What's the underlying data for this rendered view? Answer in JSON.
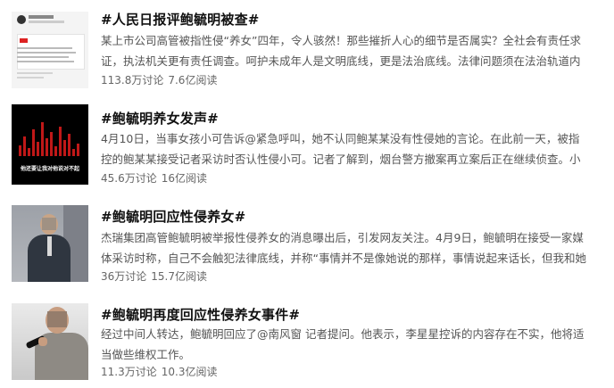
{
  "items": [
    {
      "title": "#人民日报评鲍毓明被查#",
      "desc": "某上市公司高管被指性侵“养女”四年，令人骇然！那些摧折人心的细节是否属实？全社会有责任求证，执法机关更有责任调查。呵护未成年人是文明底线，更是法治底线。法律问题须在法治轨道内解决。...",
      "discussions": "113.8万讨论",
      "reads": "7.6亿阅读"
    },
    {
      "title": "#鲍毓明养女发声#",
      "desc": "4月10日，当事女孩小可告诉@紧急呼叫，她不认同鲍某某没有性侵她的言论。在此前一天，被指控的鲍某某接受记者采访时否认性侵小可。记者了解到，烟台警方撤案再立案后正在继续侦查。小可表...",
      "discussions": "45.6万讨论",
      "reads": "16亿阅读",
      "thumb_caption": "他还要让我对他说对不起"
    },
    {
      "title": "#鲍毓明回应性侵养女#",
      "desc": "杰瑞集团高管鲍毓明被举报性侵养女的消息曝出后，引发网友关注。4月9日，鲍毓明在接受一家媒体采访时称，自己不会触犯法律底线，并称“事情并不是像她说的那样，事情说起来话长，但我和她从来...",
      "discussions": "36万讨论",
      "reads": "15.7亿阅读"
    },
    {
      "title": "#鲍毓明再度回应性侵养女事件#",
      "desc": "经过中间人转达，鲍毓明回应了@南风窗 记者提问。他表示，李星星控诉的内容存在不实，他将适当做些维权工作。",
      "discussions": "11.3万讨论",
      "reads": "10.3亿阅读"
    }
  ]
}
